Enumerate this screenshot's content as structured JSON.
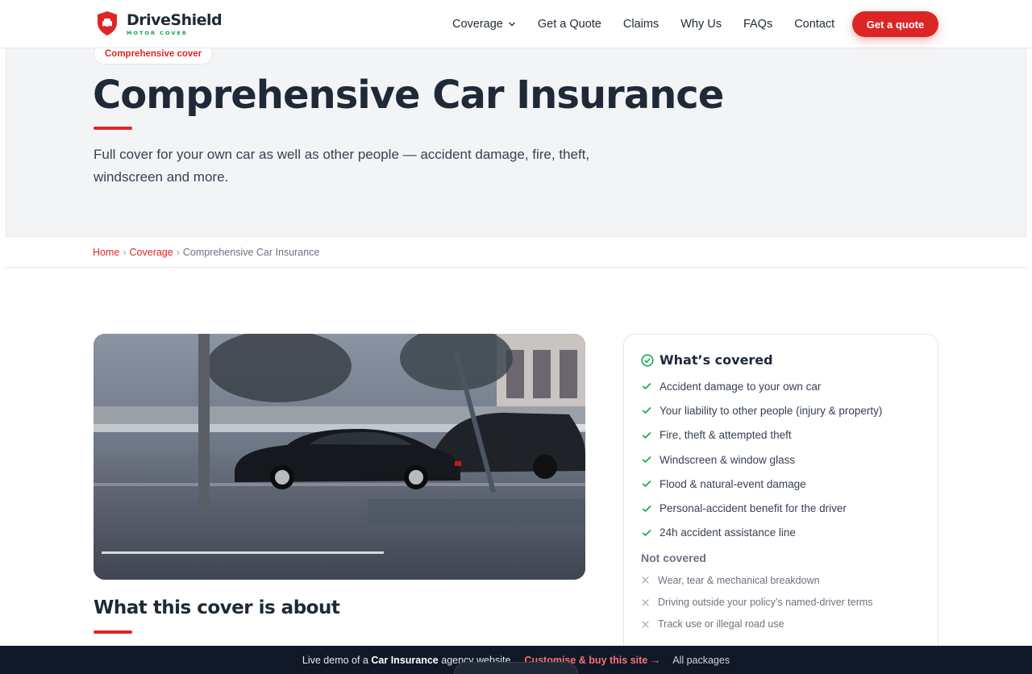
{
  "header": {
    "logo_name": "DriveShield",
    "logo_tagline": "MOTOR COVER",
    "nav": [
      {
        "label": "Coverage"
      },
      {
        "label": "Get a Quote"
      },
      {
        "label": "Claims"
      },
      {
        "label": "Why Us"
      },
      {
        "label": "FAQs"
      },
      {
        "label": "Contact"
      }
    ],
    "cta_label": "Get a quote"
  },
  "hero": {
    "pill": "Comprehensive cover",
    "title": "Comprehensive Car Insurance",
    "subtitle": "Full cover for your own car as well as other people — accident damage, fire, theft, windscreen and more."
  },
  "breadcrumb": {
    "home": "Home",
    "sep": "›",
    "coverage": "Coverage",
    "current": "Comprehensive Car Insurance"
  },
  "main": {
    "section_title": "What this cover is about"
  },
  "coverage_card": {
    "title": "What’s covered",
    "covered": [
      "Accident damage to your own car",
      "Your liability to other people (injury & property)",
      "Fire, theft & attempted theft",
      "Windscreen & window glass",
      "Flood & natural-event damage",
      "Personal-accident benefit for the driver",
      "24h accident assistance line"
    ],
    "not_title": "Not covered",
    "not_covered": [
      "Wear, tear & mechanical breakdown",
      "Driving outside your policy’s named-driver terms",
      "Track use or illegal road use"
    ]
  },
  "demo_bar": {
    "prefix": "Live demo of a ",
    "bold": "Car Insurance",
    "suffix": " agency website",
    "buy": "Customise & buy this site →",
    "packages": "All packages"
  },
  "colors": {
    "accent": "#dc2626",
    "check": "#16a34a",
    "text_dark": "#1f2937",
    "hero_bg": "#f3f4f6",
    "banner_bg": "#111827"
  }
}
